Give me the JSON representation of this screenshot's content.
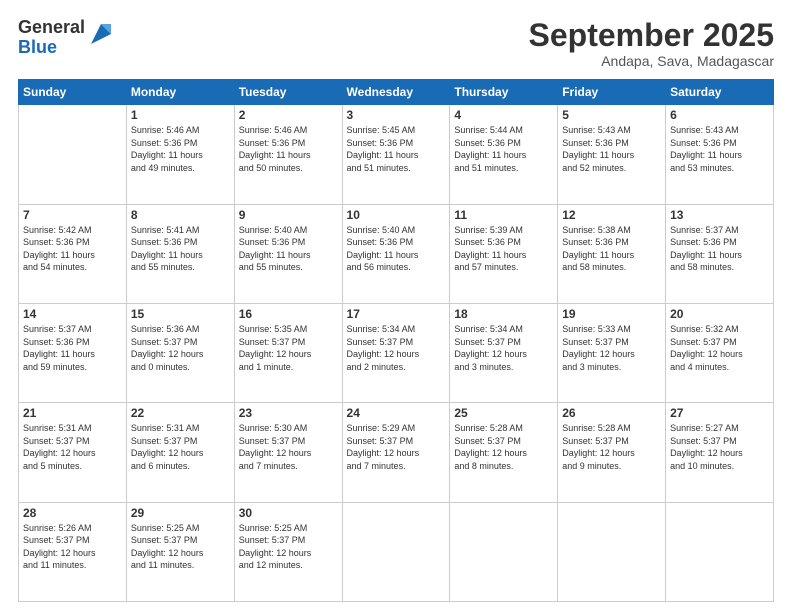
{
  "logo": {
    "general": "General",
    "blue": "Blue"
  },
  "header": {
    "month": "September 2025",
    "location": "Andapa, Sava, Madagascar"
  },
  "days_of_week": [
    "Sunday",
    "Monday",
    "Tuesday",
    "Wednesday",
    "Thursday",
    "Friday",
    "Saturday"
  ],
  "weeks": [
    [
      {
        "day": "",
        "info": ""
      },
      {
        "day": "1",
        "info": "Sunrise: 5:46 AM\nSunset: 5:36 PM\nDaylight: 11 hours\nand 49 minutes."
      },
      {
        "day": "2",
        "info": "Sunrise: 5:46 AM\nSunset: 5:36 PM\nDaylight: 11 hours\nand 50 minutes."
      },
      {
        "day": "3",
        "info": "Sunrise: 5:45 AM\nSunset: 5:36 PM\nDaylight: 11 hours\nand 51 minutes."
      },
      {
        "day": "4",
        "info": "Sunrise: 5:44 AM\nSunset: 5:36 PM\nDaylight: 11 hours\nand 51 minutes."
      },
      {
        "day": "5",
        "info": "Sunrise: 5:43 AM\nSunset: 5:36 PM\nDaylight: 11 hours\nand 52 minutes."
      },
      {
        "day": "6",
        "info": "Sunrise: 5:43 AM\nSunset: 5:36 PM\nDaylight: 11 hours\nand 53 minutes."
      }
    ],
    [
      {
        "day": "7",
        "info": "Sunrise: 5:42 AM\nSunset: 5:36 PM\nDaylight: 11 hours\nand 54 minutes."
      },
      {
        "day": "8",
        "info": "Sunrise: 5:41 AM\nSunset: 5:36 PM\nDaylight: 11 hours\nand 55 minutes."
      },
      {
        "day": "9",
        "info": "Sunrise: 5:40 AM\nSunset: 5:36 PM\nDaylight: 11 hours\nand 55 minutes."
      },
      {
        "day": "10",
        "info": "Sunrise: 5:40 AM\nSunset: 5:36 PM\nDaylight: 11 hours\nand 56 minutes."
      },
      {
        "day": "11",
        "info": "Sunrise: 5:39 AM\nSunset: 5:36 PM\nDaylight: 11 hours\nand 57 minutes."
      },
      {
        "day": "12",
        "info": "Sunrise: 5:38 AM\nSunset: 5:36 PM\nDaylight: 11 hours\nand 58 minutes."
      },
      {
        "day": "13",
        "info": "Sunrise: 5:37 AM\nSunset: 5:36 PM\nDaylight: 11 hours\nand 58 minutes."
      }
    ],
    [
      {
        "day": "14",
        "info": "Sunrise: 5:37 AM\nSunset: 5:36 PM\nDaylight: 11 hours\nand 59 minutes."
      },
      {
        "day": "15",
        "info": "Sunrise: 5:36 AM\nSunset: 5:37 PM\nDaylight: 12 hours\nand 0 minutes."
      },
      {
        "day": "16",
        "info": "Sunrise: 5:35 AM\nSunset: 5:37 PM\nDaylight: 12 hours\nand 1 minute."
      },
      {
        "day": "17",
        "info": "Sunrise: 5:34 AM\nSunset: 5:37 PM\nDaylight: 12 hours\nand 2 minutes."
      },
      {
        "day": "18",
        "info": "Sunrise: 5:34 AM\nSunset: 5:37 PM\nDaylight: 12 hours\nand 3 minutes."
      },
      {
        "day": "19",
        "info": "Sunrise: 5:33 AM\nSunset: 5:37 PM\nDaylight: 12 hours\nand 3 minutes."
      },
      {
        "day": "20",
        "info": "Sunrise: 5:32 AM\nSunset: 5:37 PM\nDaylight: 12 hours\nand 4 minutes."
      }
    ],
    [
      {
        "day": "21",
        "info": "Sunrise: 5:31 AM\nSunset: 5:37 PM\nDaylight: 12 hours\nand 5 minutes."
      },
      {
        "day": "22",
        "info": "Sunrise: 5:31 AM\nSunset: 5:37 PM\nDaylight: 12 hours\nand 6 minutes."
      },
      {
        "day": "23",
        "info": "Sunrise: 5:30 AM\nSunset: 5:37 PM\nDaylight: 12 hours\nand 7 minutes."
      },
      {
        "day": "24",
        "info": "Sunrise: 5:29 AM\nSunset: 5:37 PM\nDaylight: 12 hours\nand 7 minutes."
      },
      {
        "day": "25",
        "info": "Sunrise: 5:28 AM\nSunset: 5:37 PM\nDaylight: 12 hours\nand 8 minutes."
      },
      {
        "day": "26",
        "info": "Sunrise: 5:28 AM\nSunset: 5:37 PM\nDaylight: 12 hours\nand 9 minutes."
      },
      {
        "day": "27",
        "info": "Sunrise: 5:27 AM\nSunset: 5:37 PM\nDaylight: 12 hours\nand 10 minutes."
      }
    ],
    [
      {
        "day": "28",
        "info": "Sunrise: 5:26 AM\nSunset: 5:37 PM\nDaylight: 12 hours\nand 11 minutes."
      },
      {
        "day": "29",
        "info": "Sunrise: 5:25 AM\nSunset: 5:37 PM\nDaylight: 12 hours\nand 11 minutes."
      },
      {
        "day": "30",
        "info": "Sunrise: 5:25 AM\nSunset: 5:37 PM\nDaylight: 12 hours\nand 12 minutes."
      },
      {
        "day": "",
        "info": ""
      },
      {
        "day": "",
        "info": ""
      },
      {
        "day": "",
        "info": ""
      },
      {
        "day": "",
        "info": ""
      }
    ]
  ]
}
